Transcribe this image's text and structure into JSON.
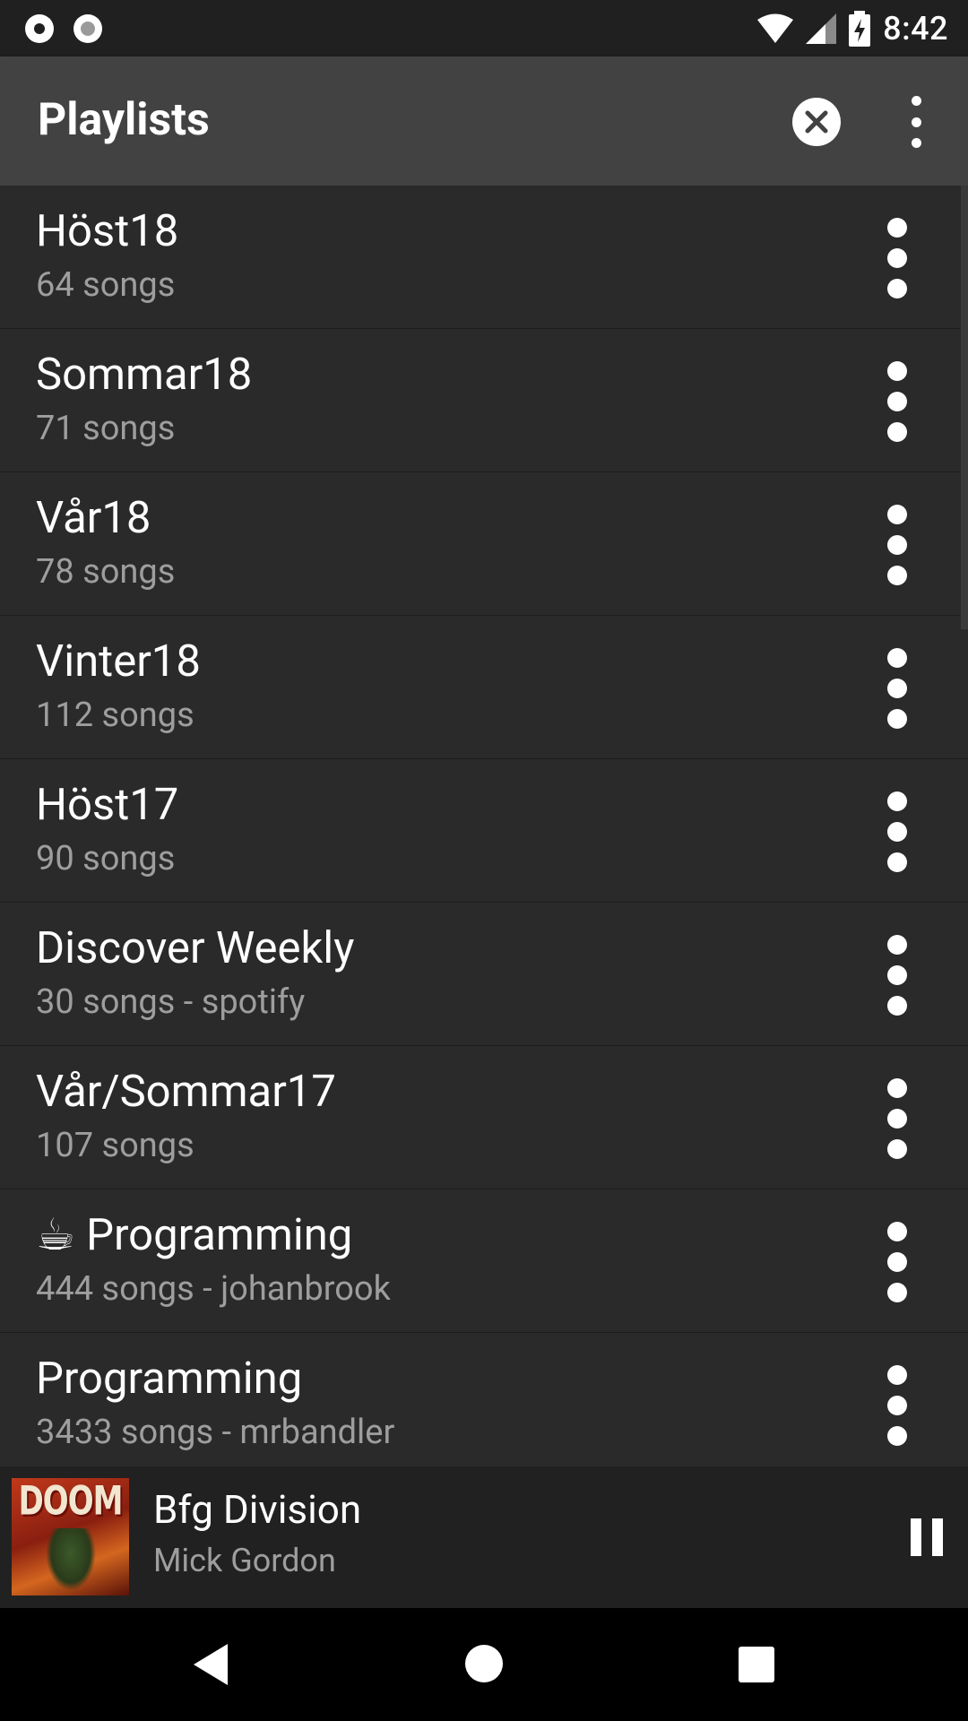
{
  "status_bar": {
    "time": "8:42",
    "icons": [
      "record-icon",
      "sync-icon",
      "wifi-icon",
      "cell-signal-icon",
      "battery-charging-icon"
    ]
  },
  "app_bar": {
    "title": "Playlists",
    "actions": [
      "clear-icon",
      "more-vert-icon"
    ]
  },
  "playlists": [
    {
      "title": "Höst18",
      "subtitle": "64 songs"
    },
    {
      "title": "Sommar18",
      "subtitle": "71 songs"
    },
    {
      "title": "Vår18",
      "subtitle": "78 songs"
    },
    {
      "title": "Vinter18",
      "subtitle": "112 songs"
    },
    {
      "title": "Höst17",
      "subtitle": "90 songs"
    },
    {
      "title": "Discover Weekly",
      "subtitle": "30 songs - spotify"
    },
    {
      "title": "Vår/Sommar17",
      "subtitle": "107 songs"
    },
    {
      "title": "☕ Programming",
      "subtitle": "444 songs - johanbrook"
    },
    {
      "title": "Programming",
      "subtitle": "3433 songs - mrbandler"
    }
  ],
  "now_playing": {
    "track": "Bfg Division",
    "artist": "Mick Gordon",
    "album_art_text": "DOOM"
  },
  "colors": {
    "app_bar": "#424242",
    "list_background": "#2a2a2a",
    "secondary_text": "#9e9e9e",
    "status_bar": "#202020"
  }
}
